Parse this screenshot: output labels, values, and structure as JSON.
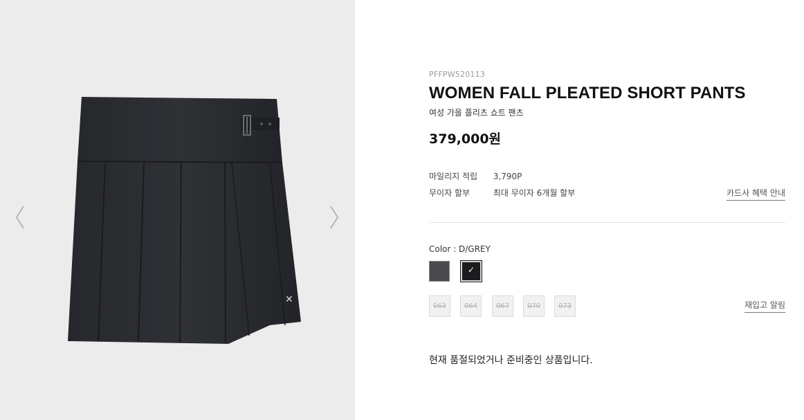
{
  "gallery": {
    "prev_icon": "chevron-left-icon",
    "next_icon": "chevron-right-icon"
  },
  "product": {
    "code": "PFFPW520113",
    "title": "WOMEN FALL PLEATED SHORT PANTS",
    "subtitle": "여성 가을 플리츠 쇼트 팬츠",
    "price": "379,000원"
  },
  "benefits": {
    "mileage_label": "마일리지 적립",
    "mileage_value": "3,790P",
    "installment_label": "무이자 할부",
    "installment_value": "최대 무이자 6개월 할부",
    "card_link": "카드사 혜택 안내"
  },
  "options": {
    "color_label": "Color : D/GREY",
    "swatches": [
      {
        "color": "#4a4a4c",
        "selected": false
      },
      {
        "color": "#1c1c1e",
        "selected": true,
        "check": "✓"
      }
    ],
    "sizes": [
      "063",
      "064",
      "067",
      "070",
      "073"
    ],
    "restock_link": "재입고 알림"
  },
  "status": {
    "message": "현재 품절되었거나 준비중인 상품입니다."
  }
}
